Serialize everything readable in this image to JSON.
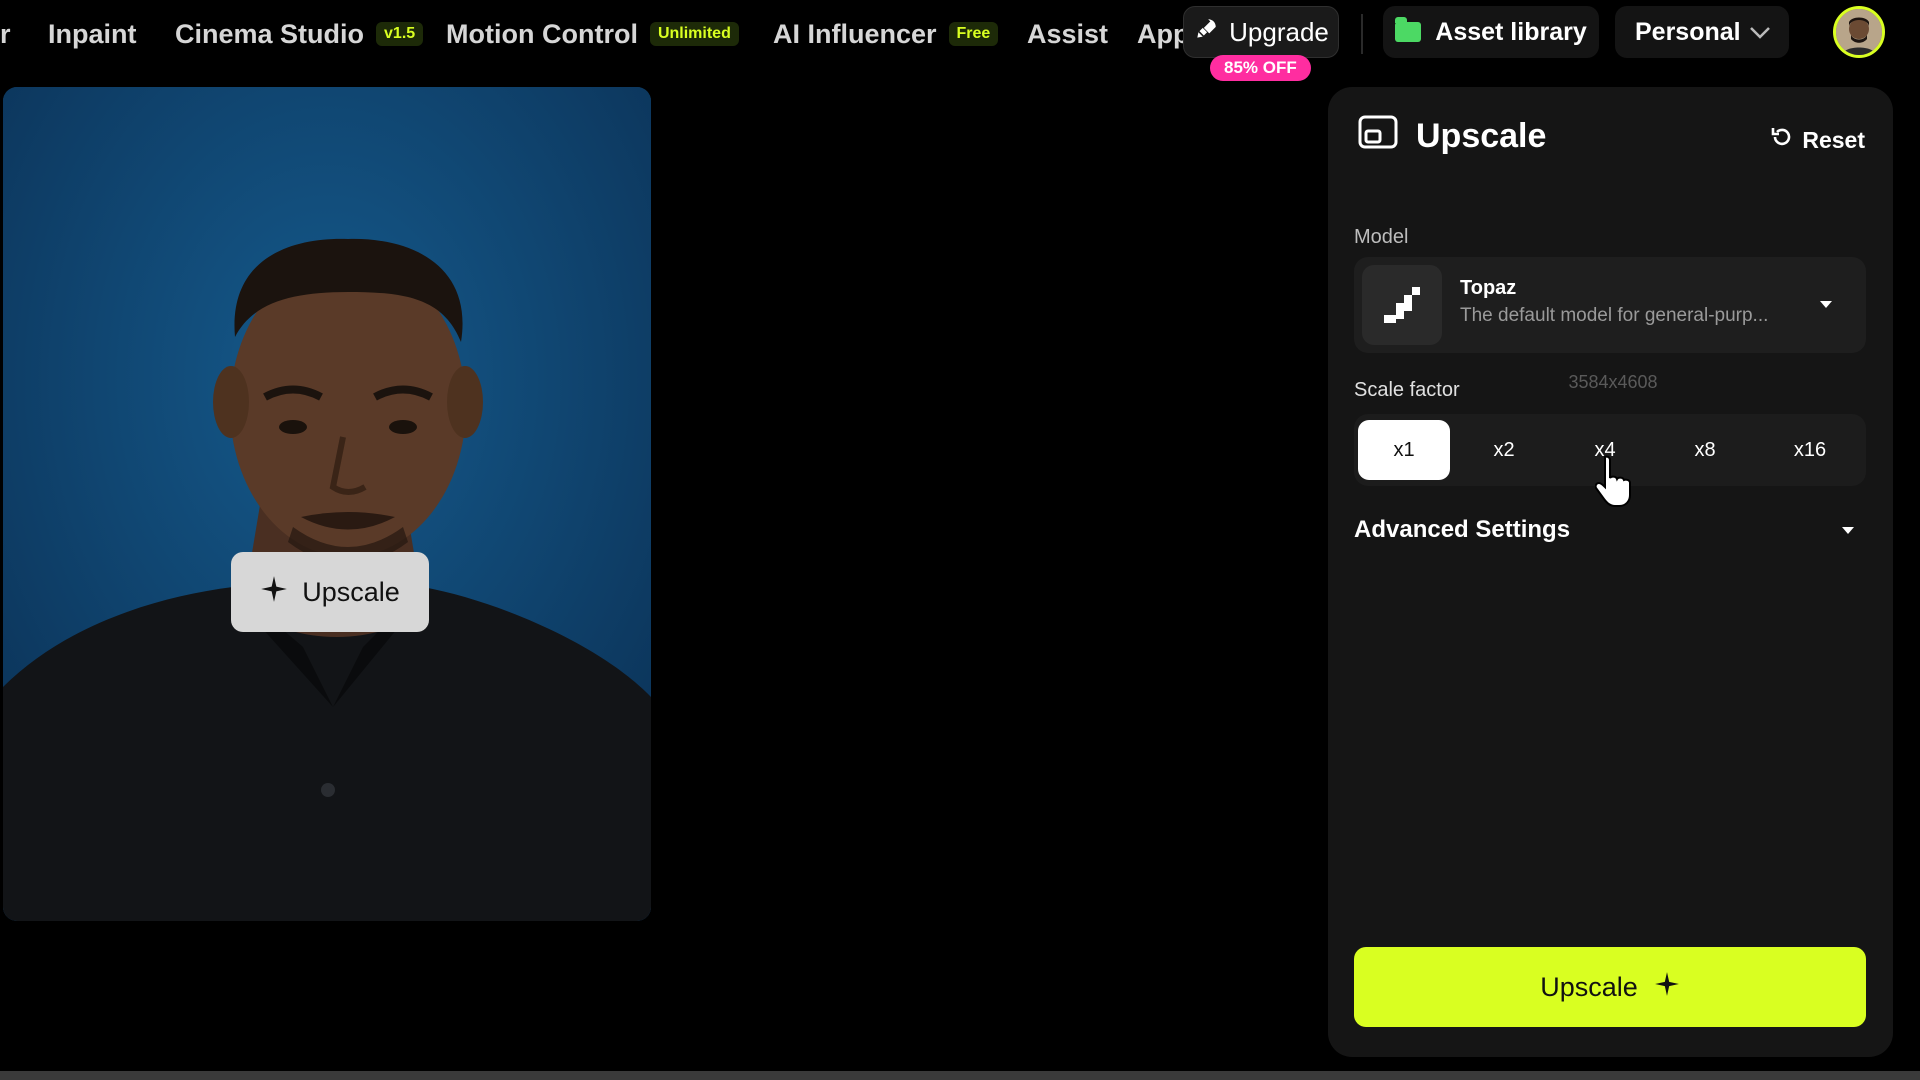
{
  "nav": {
    "partial_item": "r",
    "items": [
      {
        "label": "Inpaint",
        "badge": ""
      },
      {
        "label": "Cinema Studio",
        "badge": "v1.5"
      },
      {
        "label": "Motion Control",
        "badge": "Unlimited"
      },
      {
        "label": "AI Influencer",
        "badge": "Free"
      },
      {
        "label": "Assist",
        "badge": ""
      },
      {
        "label": "App",
        "badge": ""
      }
    ],
    "upgrade_label": "Upgrade",
    "discount": "85% OFF",
    "asset_library": "Asset library",
    "workspace": "Personal"
  },
  "preview": {
    "overlay_button": "Upscale"
  },
  "panel": {
    "title": "Upscale",
    "reset": "Reset",
    "model_label": "Model",
    "model_name": "Topaz",
    "model_desc": "The default model for general-purp...",
    "scale_label": "Scale factor",
    "resolution_hint": "3584x4608",
    "scale_options": [
      "x1",
      "x2",
      "x4",
      "x8",
      "x16"
    ],
    "selected_scale": "x1",
    "advanced": "Advanced Settings",
    "submit": "Upscale"
  },
  "colors": {
    "accent": "#d9ff21",
    "discount": "#ff2da0",
    "panel_bg": "#151515",
    "photo_bg": "#0d3a63"
  },
  "icons": [
    "rocket-icon",
    "folder-icon",
    "chevron-down-icon",
    "upscale-panel-icon",
    "reset-icon",
    "sparkle-icon",
    "pointer-cursor-icon"
  ]
}
